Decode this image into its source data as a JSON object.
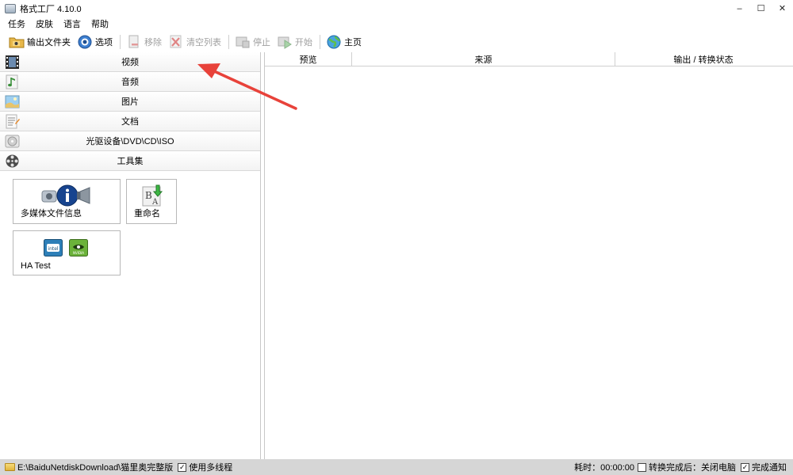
{
  "window": {
    "title": "格式工厂 4.10.0",
    "controls": {
      "minimize": "–",
      "maximize": "☐",
      "close": "✕"
    }
  },
  "menu": [
    "任务",
    "皮肤",
    "语言",
    "帮助"
  ],
  "toolbar": {
    "output_folder": "输出文件夹",
    "options": "选项",
    "remove": "移除",
    "clear_list": "清空列表",
    "stop": "停止",
    "start": "开始",
    "home": "主页"
  },
  "categories": [
    {
      "label": "视频",
      "icon": "film-icon"
    },
    {
      "label": "音频",
      "icon": "music-note-icon"
    },
    {
      "label": "图片",
      "icon": "picture-icon"
    },
    {
      "label": "文档",
      "icon": "document-icon"
    },
    {
      "label": "光驱设备\\DVD\\CD\\ISO",
      "icon": "disc-icon"
    },
    {
      "label": "工具集",
      "icon": "film-reel-icon"
    }
  ],
  "tools": {
    "media_info": "多媒体文件信息",
    "rename": "重命名",
    "ha_test": "HA Test",
    "intel_logo": "intel",
    "nvidia_logo": "NVIDIA"
  },
  "table": {
    "columns": [
      "预览",
      "来源",
      "输出 / 转换状态"
    ]
  },
  "status": {
    "output_path": "E:\\BaiduNetdiskDownload\\猫里奥完整版",
    "multithread_label": "使用多线程",
    "multithread_checked": "✓",
    "elapsed_label": "耗时：00:00:00",
    "after_convert_label": "转换完成后：关闭电脑",
    "after_convert_checked": "",
    "notify_label": "完成通知",
    "notify_checked": "✓"
  },
  "colors": {
    "annotation_arrow": "#e8423a",
    "statusbar_bg": "#d6d6d6",
    "disabled_text": "#a0a0a0"
  }
}
